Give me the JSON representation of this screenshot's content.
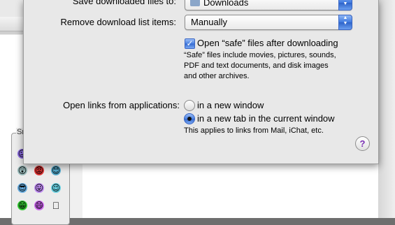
{
  "downloads": {
    "save_label": "Save downloaded files to:",
    "save_value": "Downloads",
    "remove_label": "Remove download list items:",
    "remove_value": "Manually",
    "safe_checkbox_label": "Open “safe” files after downloading",
    "safe_checked": true,
    "safe_description": [
      "“Safe” files include movies, pictures, sounds,",
      "PDF and text documents, and disk images",
      "and other archives."
    ]
  },
  "links": {
    "label": "Open links from applications:",
    "options": [
      {
        "label": "in a new window",
        "selected": false
      },
      {
        "label": "in a new tab in the current window",
        "selected": true
      }
    ],
    "note": "This applies to links from Mail, iChat, etc."
  },
  "help_button": "?",
  "background": {
    "box_legend": "Sm",
    "smileys": [
      "😐",
      "😲",
      "😡",
      "😊",
      "😎",
      "😛",
      "😉",
      "😁",
      "😄",
      ""
    ]
  }
}
